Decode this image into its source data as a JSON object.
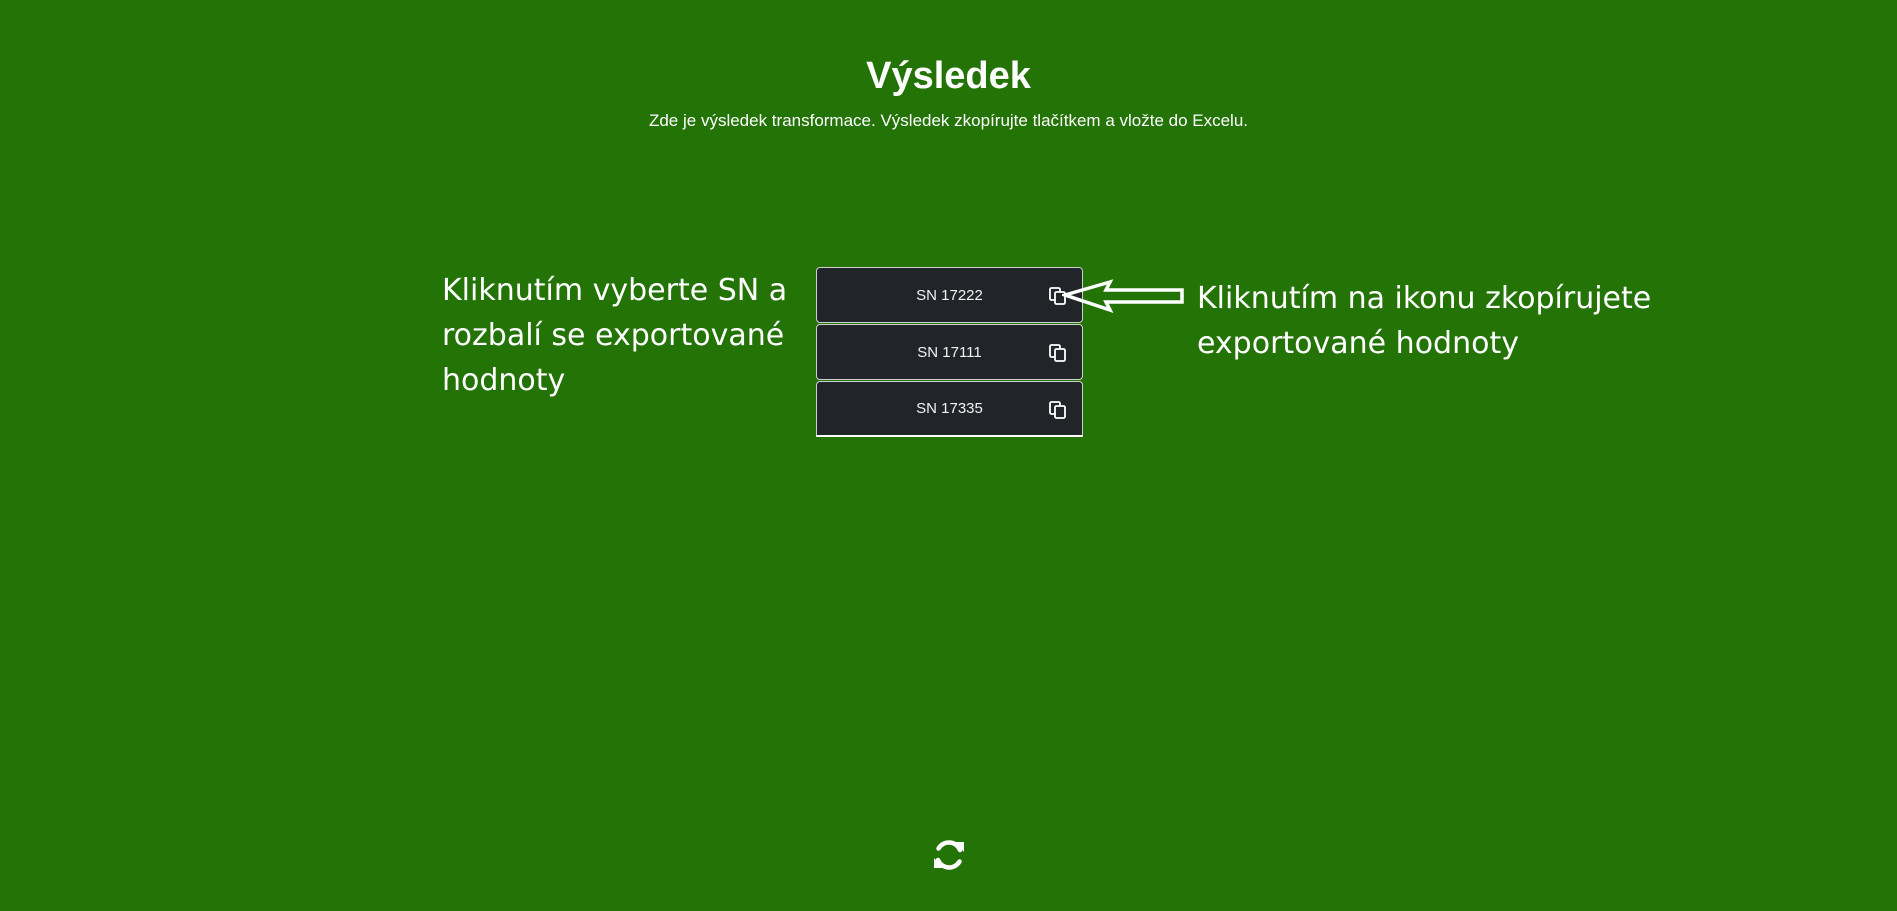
{
  "page": {
    "title": "Výsledek",
    "subtitle": "Zde je výsledek transformace. Výsledek zkopírujte tlačítkem a vložte do Excelu."
  },
  "results": [
    {
      "label": "SN 17222",
      "icon": "copy-icon"
    },
    {
      "label": "SN 17111",
      "icon": "copy-icon"
    },
    {
      "label": "SN 17335",
      "icon": "copy-icon"
    }
  ],
  "annotations": {
    "left": [
      "Kliknutím vyberte SN a",
      "rozbalí se exportované",
      "hodnoty"
    ],
    "right": [
      "Kliknutím na ikonu zkopírujete",
      "exportované hodnoty"
    ]
  },
  "footer": {
    "refresh_icon": "refresh-icon"
  },
  "colors": {
    "background": "#237307",
    "item_background": "#212529",
    "text": "#ffffff"
  }
}
